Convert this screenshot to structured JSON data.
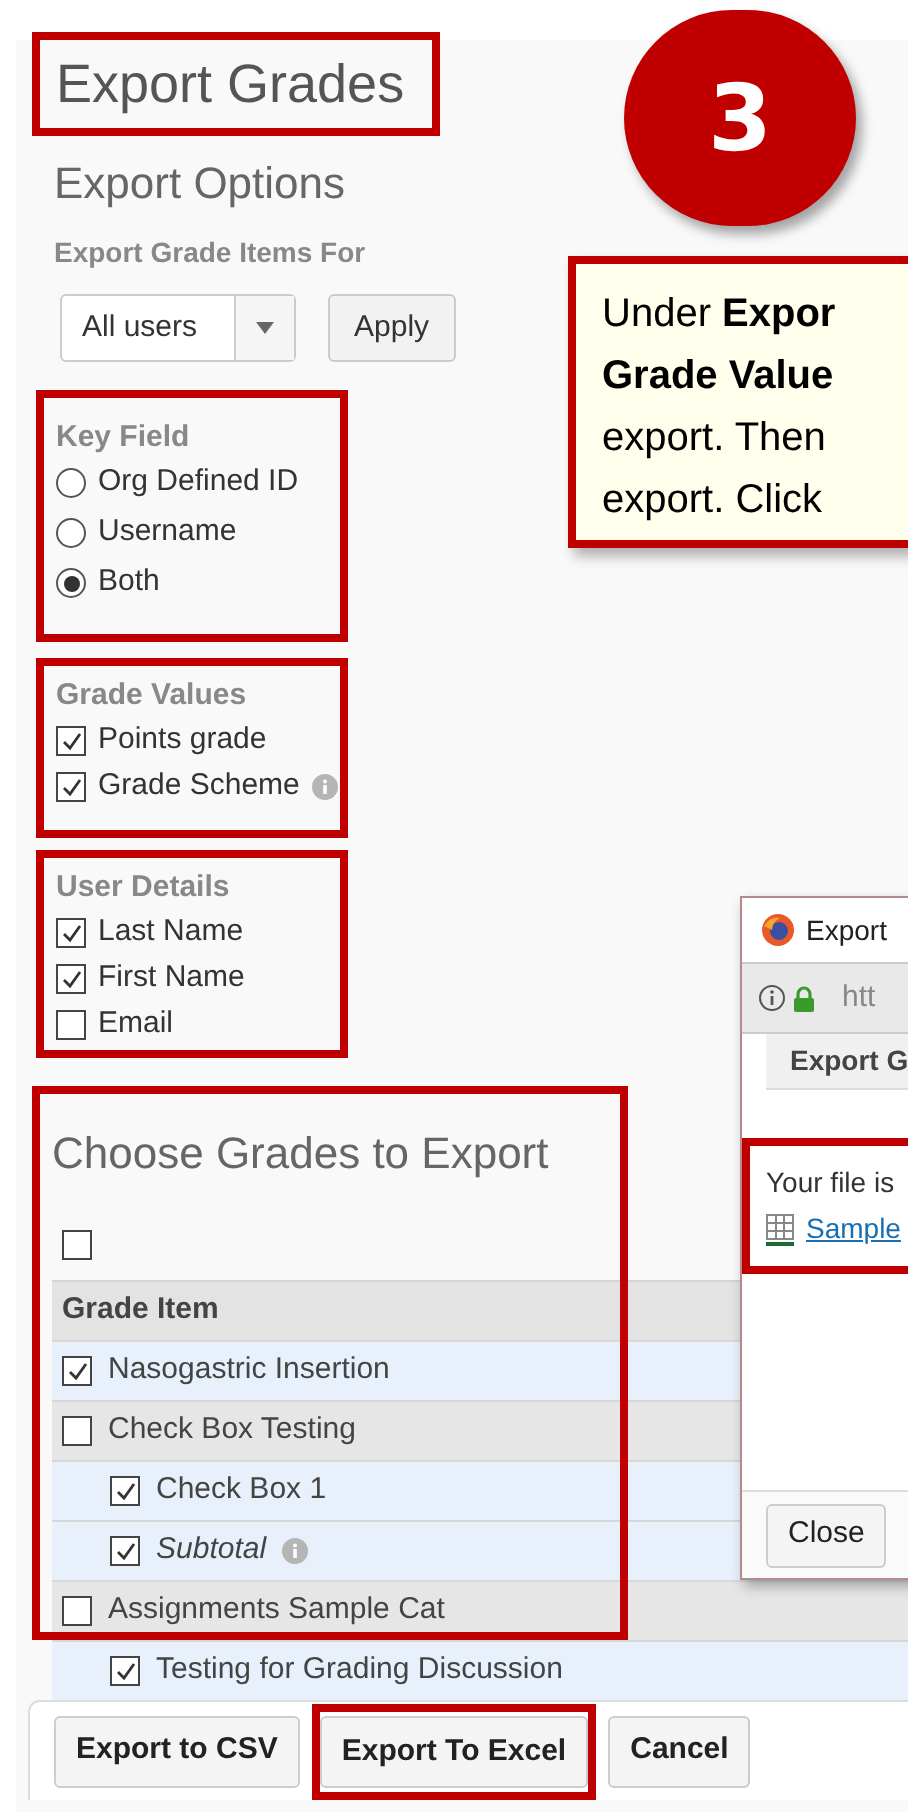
{
  "page_title": {
    "text": "Export Grades",
    "highlighted": true
  },
  "section_title": "Export Options",
  "export_for": {
    "label": "Export Grade Items For",
    "select_value": "All users",
    "apply_button": "Apply"
  },
  "key_field": {
    "title": "Key Field",
    "highlighted": true,
    "options": [
      {
        "label": "Org Defined ID",
        "selected": false
      },
      {
        "label": "Username",
        "selected": false
      },
      {
        "label": "Both",
        "selected": true
      }
    ]
  },
  "grade_values": {
    "title": "Grade Values",
    "highlighted": true,
    "options": [
      {
        "label": "Points grade",
        "checked": true
      },
      {
        "label": "Grade Scheme",
        "checked": true,
        "info": true
      }
    ]
  },
  "user_details": {
    "title": "User Details",
    "highlighted": true,
    "options": [
      {
        "label": "Last Name",
        "checked": true
      },
      {
        "label": "First Name",
        "checked": true
      },
      {
        "label": "Email",
        "checked": false
      }
    ]
  },
  "choose_grades": {
    "title": "Choose Grades to Export",
    "highlighted": true,
    "select_all_checked": false,
    "column": "Grade Item",
    "rows": [
      {
        "kind": "item",
        "label": "Nasogastric Insertion",
        "checked": true
      },
      {
        "kind": "category",
        "label": "Check Box Testing",
        "checked": false,
        "children": [
          {
            "kind": "item",
            "label": "Check Box 1",
            "checked": true
          },
          {
            "kind": "subtotal",
            "label": "Subtotal",
            "checked": true,
            "info": true
          }
        ]
      },
      {
        "kind": "category",
        "label": "Assignments Sample Cat",
        "checked": false,
        "children": [
          {
            "kind": "item",
            "label": "Testing for Grading Discussion",
            "checked": true
          }
        ]
      }
    ]
  },
  "buttons": [
    {
      "label": "Export to CSV",
      "highlighted": false
    },
    {
      "label": "Export To Excel",
      "highlighted": true
    },
    {
      "label": "Cancel",
      "highlighted": false
    }
  ],
  "step_badge": "3",
  "callout": {
    "lines": [
      "Under **Expor**",
      "**Grade Value**",
      "export. Then",
      "export. Click"
    ]
  },
  "popup": {
    "title": "Export",
    "address": "htt",
    "heading": "Export G",
    "message": "Your file is",
    "file_link": "Sample",
    "close_button": "Close",
    "highlighted": true
  }
}
